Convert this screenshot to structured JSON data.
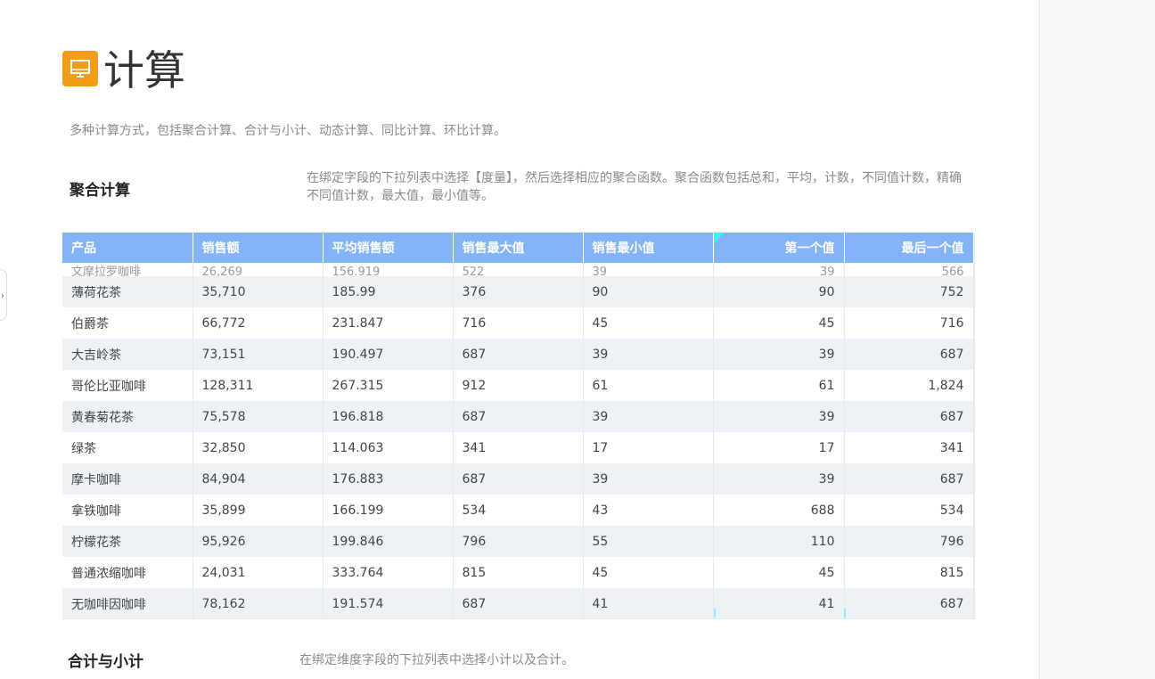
{
  "page": {
    "title": "计算",
    "description": "多种计算方式，包括聚合计算、合计与小计、动态计算、同比计算、环比计算。"
  },
  "section1": {
    "title": "聚合计算",
    "description": "在绑定字段的下拉列表中选择【度量】，然后选择相应的聚合函数。聚合函数包括总和，平均，计数，不同值计数，精确不同值计数，最大值，最小值等。"
  },
  "section2": {
    "title": "合计与小计",
    "description": "在绑定维度字段的下拉列表中选择小计以及合计。"
  },
  "table": {
    "headers": [
      "产品",
      "销售额",
      "平均销售额",
      "销售最大值",
      "销售最小值",
      "第一个值",
      "最后一个值"
    ],
    "partial_row": [
      "文摩拉罗咖啡",
      "26,269",
      "156.919",
      "522",
      "39",
      "39",
      "566"
    ],
    "rows": [
      [
        "薄荷花茶",
        "35,710",
        "185.99",
        "376",
        "90",
        "90",
        "752"
      ],
      [
        "伯爵茶",
        "66,772",
        "231.847",
        "716",
        "45",
        "45",
        "716"
      ],
      [
        "大吉岭茶",
        "73,151",
        "190.497",
        "687",
        "39",
        "39",
        "687"
      ],
      [
        "哥伦比亚咖啡",
        "128,311",
        "267.315",
        "912",
        "61",
        "61",
        "1,824"
      ],
      [
        "黄春菊花茶",
        "75,578",
        "196.818",
        "687",
        "39",
        "39",
        "687"
      ],
      [
        "绿茶",
        "32,850",
        "114.063",
        "341",
        "17",
        "17",
        "341"
      ],
      [
        "摩卡咖啡",
        "84,904",
        "176.883",
        "687",
        "39",
        "39",
        "687"
      ],
      [
        "拿铁咖啡",
        "35,899",
        "166.199",
        "534",
        "43",
        "688",
        "534"
      ],
      [
        "柠檬花茶",
        "95,926",
        "199.846",
        "796",
        "55",
        "110",
        "796"
      ],
      [
        "普通浓缩咖啡",
        "24,031",
        "333.764",
        "815",
        "45",
        "45",
        "815"
      ],
      [
        "无咖啡因咖啡",
        "78,162",
        "191.574",
        "687",
        "41",
        "41",
        "687"
      ]
    ]
  },
  "colors": {
    "header_bg": "#82b4f7",
    "icon_bg": "#f29c1a",
    "stripe": "#eef2f7"
  },
  "icons": {
    "title_icon": "monitor-icon",
    "side_toggle": "chevron-right-icon"
  }
}
